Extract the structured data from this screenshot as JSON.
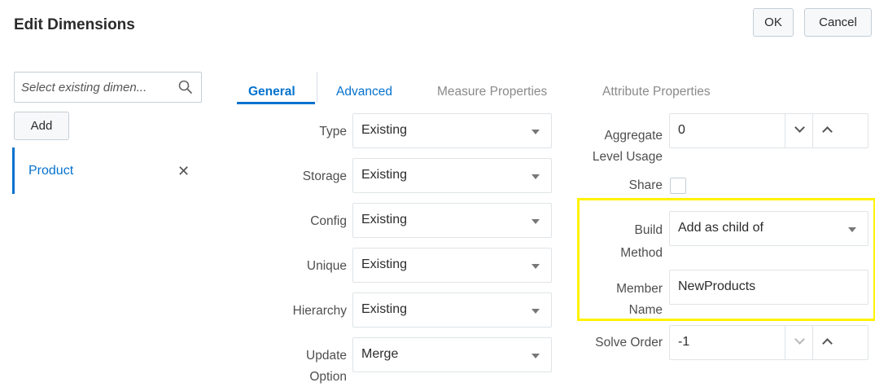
{
  "header": {
    "title": "Edit Dimensions",
    "ok_label": "OK",
    "cancel_label": "Cancel"
  },
  "sidebar": {
    "search_placeholder": "Select existing dimen...",
    "add_label": "Add",
    "items": [
      {
        "label": "Product",
        "remove_icon": "close-icon"
      }
    ]
  },
  "tabs": [
    {
      "label": "General",
      "state": "active"
    },
    {
      "label": "Advanced",
      "state": "enabled"
    },
    {
      "label": "Measure Properties",
      "state": "disabled"
    },
    {
      "label": "Attribute Properties",
      "state": "disabled"
    }
  ],
  "general": {
    "fields": [
      {
        "label": "Type",
        "value": "Existing"
      },
      {
        "label": "Storage",
        "value": "Existing"
      },
      {
        "label": "Config",
        "value": "Existing"
      },
      {
        "label": "Unique",
        "value": "Existing"
      },
      {
        "label": "Hierarchy",
        "value": "Existing"
      },
      {
        "label_line1": "Update",
        "label_line2": "Option",
        "value": "Merge"
      }
    ],
    "aggregate": {
      "label_line1": "Aggregate",
      "label_line2": "Level Usage",
      "value": "0"
    },
    "share": {
      "label": "Share",
      "checked": false
    },
    "build_method": {
      "label_line1": "Build",
      "label_line2": "Method",
      "value": "Add as child of"
    },
    "member_name": {
      "label_line1": "Member",
      "label_line2": "Name",
      "value": "NewProducts"
    },
    "solve_order": {
      "label": "Solve Order",
      "value": "-1"
    }
  },
  "colors": {
    "accent": "#0572ce",
    "highlight": "#fff200"
  }
}
